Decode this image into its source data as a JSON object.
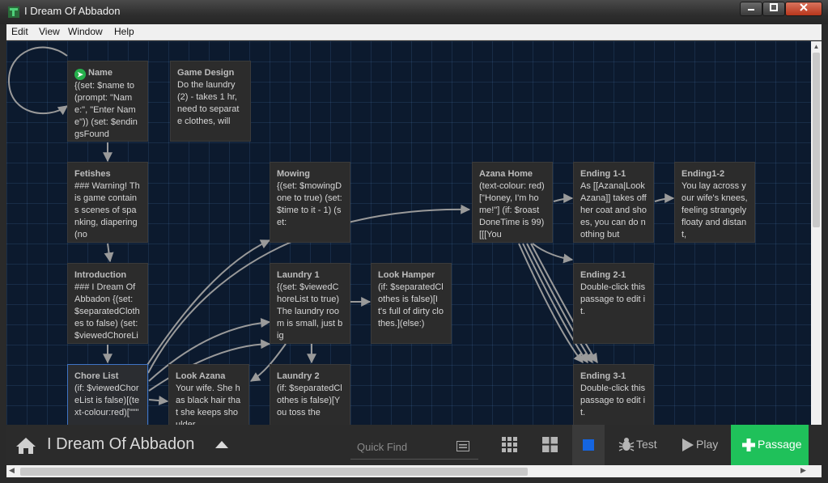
{
  "window": {
    "title": "I Dream Of Abbadon"
  },
  "menubar": {
    "items": [
      "Edit",
      "View",
      "Window",
      "Help"
    ]
  },
  "passages": [
    {
      "id": "name",
      "title": "Name",
      "excerpt": "{(set: $name to (prompt: \"Name:\", \"Enter Name\")) (set: $endingsFound",
      "start": true
    },
    {
      "id": "game-design",
      "title": "Game Design",
      "excerpt": "Do the laundry (2) - takes 1 hr, need to separate clothes, will"
    },
    {
      "id": "fetishes",
      "title": "Fetishes",
      "excerpt": "### Warning! This game contains scenes of spanking, diapering (no"
    },
    {
      "id": "mowing",
      "title": "Mowing",
      "excerpt": "{(set: $mowingDone to true) (set: $time to it - 1) (set:"
    },
    {
      "id": "azana-home",
      "title": "Azana Home",
      "excerpt": "(text-colour: red)[\"Honey, I'm home!\"] (if: $roastDoneTime is 99)[[[You"
    },
    {
      "id": "ending-1-1",
      "title": "Ending 1-1",
      "excerpt": "As [[Azana|Look Azana]] takes off her coat and shoes, you can do nothing but"
    },
    {
      "id": "ending1-2",
      "title": "Ending1-2",
      "excerpt": "You lay across your wife's knees, feeling strangely floaty and distant,"
    },
    {
      "id": "introduction",
      "title": "Introduction",
      "excerpt": "### I Dream Of Abbadon {(set: $separatedClothes to false) (set: $viewedChoreList"
    },
    {
      "id": "laundry-1",
      "title": "Laundry 1",
      "excerpt": "{(set: $viewedChoreList to true) The laundry room is small, just big"
    },
    {
      "id": "look-hamper",
      "title": "Look Hamper",
      "excerpt": "(if: $separatedClothes is false)[It's full of dirty clothes.](else:)"
    },
    {
      "id": "ending-2-1",
      "title": "Ending 2-1",
      "excerpt": "Double-click this passage to edit it."
    },
    {
      "id": "chore-list",
      "title": "Chore List",
      "excerpt": "(if: $viewedChoreList is false)[(text-colour:red)[\"\"\"",
      "selected": true
    },
    {
      "id": "look-azana",
      "title": "Look Azana",
      "excerpt": "Your wife. She has black hair that she keeps shoulder"
    },
    {
      "id": "laundry-2",
      "title": "Laundry 2",
      "excerpt": "(if: $separatedClothes is false)[You toss the"
    },
    {
      "id": "ending-3-1",
      "title": "Ending 3-1",
      "excerpt": "Double-click this passage to edit it."
    }
  ],
  "toolbar": {
    "story_title": "I Dream Of Abbadon",
    "quick_find_placeholder": "Quick Find",
    "test_label": "Test",
    "play_label": "Play",
    "new_passage_label": "Passage"
  },
  "colors": {
    "accent_green": "#1fc15a",
    "selection_blue": "#3f74c4",
    "map_background": "#0c1a2e",
    "link_gray": "#9a9a9a"
  }
}
